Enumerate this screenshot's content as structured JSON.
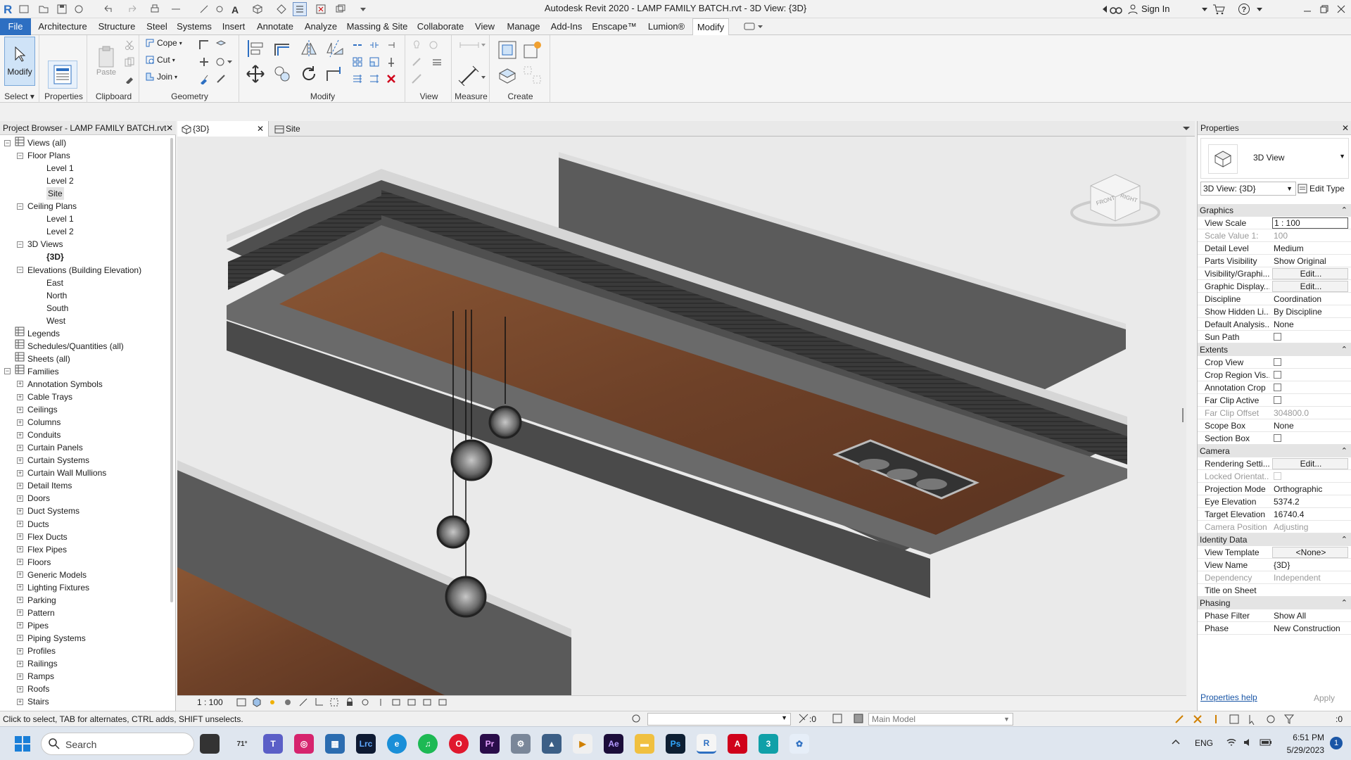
{
  "window": {
    "title": "Autodesk Revit 2020 - LAMP FAMILY BATCH.rvt - 3D View: {3D}",
    "sign_in": "Sign In"
  },
  "tabs": [
    "File",
    "Architecture",
    "Structure",
    "Steel",
    "Systems",
    "Insert",
    "Annotate",
    "Analyze",
    "Massing & Site",
    "Collaborate",
    "View",
    "Manage",
    "Add-Ins",
    "Enscape™",
    "Lumion®",
    "Modify"
  ],
  "ribbon": {
    "select": {
      "modify": "Modify",
      "label": "Select"
    },
    "properties": {
      "label": "Properties"
    },
    "clipboard": {
      "paste": "Paste",
      "label": "Clipboard"
    },
    "geometry": {
      "cope": "Cope",
      "cut": "Cut",
      "join": "Join",
      "label": "Geometry"
    },
    "modify": {
      "label": "Modify"
    },
    "view": {
      "label": "View"
    },
    "measure": {
      "label": "Measure"
    },
    "create": {
      "label": "Create"
    }
  },
  "project_browser": {
    "title": "Project Browser - LAMP FAMILY BATCH.rvt",
    "items": [
      {
        "label": "Views (all)",
        "level": 0,
        "toggle": "-"
      },
      {
        "label": "Floor Plans",
        "level": 1,
        "toggle": "-"
      },
      {
        "label": "Level 1",
        "level": 2,
        "toggle": ""
      },
      {
        "label": "Level 2",
        "level": 2,
        "toggle": ""
      },
      {
        "label": "Site",
        "level": 2,
        "toggle": ""
      },
      {
        "label": "Ceiling Plans",
        "level": 1,
        "toggle": "-"
      },
      {
        "label": "Level 1",
        "level": 2,
        "toggle": ""
      },
      {
        "label": "Level 2",
        "level": 2,
        "toggle": ""
      },
      {
        "label": "3D Views",
        "level": 1,
        "toggle": "-"
      },
      {
        "label": "{3D}",
        "level": 2,
        "toggle": "",
        "bold": true
      },
      {
        "label": "Elevations (Building Elevation)",
        "level": 1,
        "toggle": "-"
      },
      {
        "label": "East",
        "level": 2,
        "toggle": ""
      },
      {
        "label": "North",
        "level": 2,
        "toggle": ""
      },
      {
        "label": "South",
        "level": 2,
        "toggle": ""
      },
      {
        "label": "West",
        "level": 2,
        "toggle": ""
      },
      {
        "label": "Legends",
        "level": 0,
        "toggle": ""
      },
      {
        "label": "Schedules/Quantities (all)",
        "level": 0,
        "toggle": ""
      },
      {
        "label": "Sheets (all)",
        "level": 0,
        "toggle": ""
      },
      {
        "label": "Families",
        "level": 0,
        "toggle": "-"
      },
      {
        "label": "Annotation Symbols",
        "level": 1,
        "toggle": "+"
      },
      {
        "label": "Cable Trays",
        "level": 1,
        "toggle": "+"
      },
      {
        "label": "Ceilings",
        "level": 1,
        "toggle": "+"
      },
      {
        "label": "Columns",
        "level": 1,
        "toggle": "+"
      },
      {
        "label": "Conduits",
        "level": 1,
        "toggle": "+"
      },
      {
        "label": "Curtain Panels",
        "level": 1,
        "toggle": "+"
      },
      {
        "label": "Curtain Systems",
        "level": 1,
        "toggle": "+"
      },
      {
        "label": "Curtain Wall Mullions",
        "level": 1,
        "toggle": "+"
      },
      {
        "label": "Detail Items",
        "level": 1,
        "toggle": "+"
      },
      {
        "label": "Doors",
        "level": 1,
        "toggle": "+"
      },
      {
        "label": "Duct Systems",
        "level": 1,
        "toggle": "+"
      },
      {
        "label": "Ducts",
        "level": 1,
        "toggle": "+"
      },
      {
        "label": "Flex Ducts",
        "level": 1,
        "toggle": "+"
      },
      {
        "label": "Flex Pipes",
        "level": 1,
        "toggle": "+"
      },
      {
        "label": "Floors",
        "level": 1,
        "toggle": "+"
      },
      {
        "label": "Generic Models",
        "level": 1,
        "toggle": "+"
      },
      {
        "label": "Lighting Fixtures",
        "level": 1,
        "toggle": "+"
      },
      {
        "label": "Parking",
        "level": 1,
        "toggle": "+"
      },
      {
        "label": "Pattern",
        "level": 1,
        "toggle": "+"
      },
      {
        "label": "Pipes",
        "level": 1,
        "toggle": "+"
      },
      {
        "label": "Piping Systems",
        "level": 1,
        "toggle": "+"
      },
      {
        "label": "Profiles",
        "level": 1,
        "toggle": "+"
      },
      {
        "label": "Railings",
        "level": 1,
        "toggle": "+"
      },
      {
        "label": "Ramps",
        "level": 1,
        "toggle": "+"
      },
      {
        "label": "Roofs",
        "level": 1,
        "toggle": "+"
      },
      {
        "label": "Stairs",
        "level": 1,
        "toggle": "+"
      }
    ]
  },
  "view_tabs": [
    {
      "label": "{3D}"
    },
    {
      "label": "Site"
    }
  ],
  "viewcube": {
    "front": "FRONT",
    "right": "RIGHT"
  },
  "view_control_bar": {
    "scale": "1 : 100"
  },
  "properties": {
    "title": "Properties",
    "type_name": "3D View",
    "selector": "3D View: {3D}",
    "edit_type": "Edit Type",
    "groups": [
      {
        "name": "Graphics",
        "rows": [
          {
            "k": "View Scale",
            "v": "1 : 100",
            "boxed": true
          },
          {
            "k": "Scale Value    1:",
            "v": "100",
            "dim": true
          },
          {
            "k": "Detail Level",
            "v": "Medium"
          },
          {
            "k": "Parts Visibility",
            "v": "Show Original"
          },
          {
            "k": "Visibility/Graphi...",
            "v": "Edit...",
            "btn": true
          },
          {
            "k": "Graphic Display...",
            "v": "Edit...",
            "btn": true
          },
          {
            "k": "Discipline",
            "v": "Coordination"
          },
          {
            "k": "Show Hidden Li...",
            "v": "By Discipline"
          },
          {
            "k": "Default Analysis...",
            "v": "None"
          },
          {
            "k": "Sun Path",
            "v": "",
            "check": true
          }
        ]
      },
      {
        "name": "Extents",
        "rows": [
          {
            "k": "Crop View",
            "v": "",
            "check": true
          },
          {
            "k": "Crop Region Vis...",
            "v": "",
            "check": true
          },
          {
            "k": "Annotation Crop",
            "v": "",
            "check": true
          },
          {
            "k": "Far Clip Active",
            "v": "",
            "check": true
          },
          {
            "k": "Far Clip Offset",
            "v": "304800.0",
            "dim": true
          },
          {
            "k": "Scope Box",
            "v": "None"
          },
          {
            "k": "Section Box",
            "v": "",
            "check": true
          }
        ]
      },
      {
        "name": "Camera",
        "rows": [
          {
            "k": "Rendering Setti...",
            "v": "Edit...",
            "btn": true
          },
          {
            "k": "Locked Orientat...",
            "v": "",
            "check": true,
            "dim": true
          },
          {
            "k": "Projection Mode",
            "v": "Orthographic"
          },
          {
            "k": "Eye Elevation",
            "v": "5374.2"
          },
          {
            "k": "Target Elevation",
            "v": "16740.4"
          },
          {
            "k": "Camera Position",
            "v": "Adjusting",
            "dim": true
          }
        ]
      },
      {
        "name": "Identity Data",
        "rows": [
          {
            "k": "View Template",
            "v": "<None>",
            "btn": true
          },
          {
            "k": "View Name",
            "v": "{3D}"
          },
          {
            "k": "Dependency",
            "v": "Independent",
            "dim": true
          },
          {
            "k": "Title on Sheet",
            "v": ""
          }
        ]
      },
      {
        "name": "Phasing",
        "rows": [
          {
            "k": "Phase Filter",
            "v": "Show All"
          },
          {
            "k": "Phase",
            "v": "New Construction"
          }
        ]
      }
    ],
    "help": "Properties help",
    "apply": "Apply"
  },
  "status": {
    "hint": "Click to select, TAB for alternates, CTRL adds, SHIFT unselects.",
    "count": ":0",
    "model": "Main Model",
    "filter": ":0"
  },
  "taskbar": {
    "search": "Search",
    "lang": "ENG",
    "time": "6:51 PM",
    "date": "5/29/2023",
    "weather": "71°",
    "notif": "1"
  },
  "colors": {
    "accent": "#2d6fc2",
    "wood": "#7b4a2c",
    "concrete": "#5a5a5a"
  }
}
